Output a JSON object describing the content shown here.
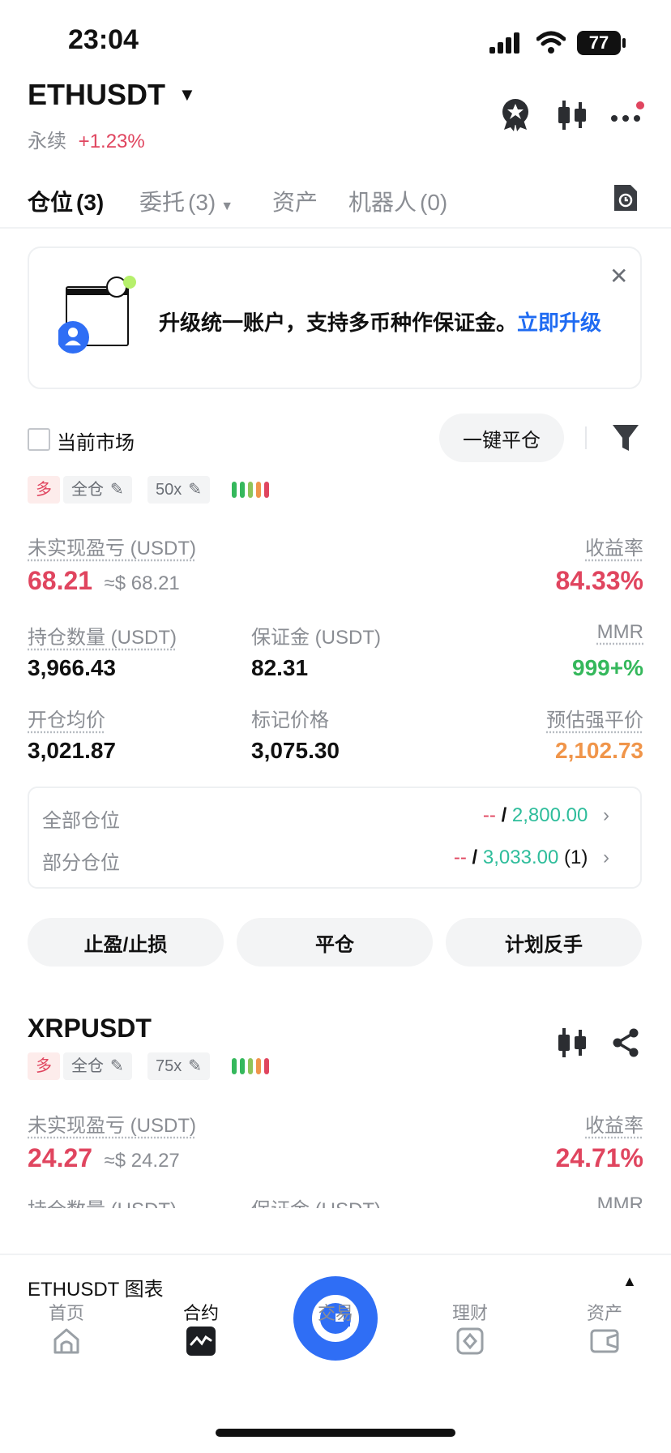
{
  "status_bar": {
    "time": "23:04",
    "battery": "77"
  },
  "header": {
    "symbol": "ETHUSDT",
    "type": "永续",
    "change": "+1.23%"
  },
  "tabs": [
    {
      "label": "仓位",
      "count": "(3)"
    },
    {
      "label": "委托",
      "count": "(3)"
    },
    {
      "label": "资产",
      "count": ""
    },
    {
      "label": "机器人",
      "count": "(0)"
    }
  ],
  "banner": {
    "text": "升级统一账户，支持多币种作保证金。",
    "link": "立即升级"
  },
  "filter_bar": {
    "current_market": "当前市场",
    "close_all": "一键平仓"
  },
  "position1": {
    "side": "多",
    "margin_mode": "全仓",
    "leverage": "50x",
    "pnl_label": "未实现盈亏 (USDT)",
    "pnl": "68.21",
    "pnl_usd": "≈$ 68.21",
    "roe_label": "收益率",
    "roe": "84.33%",
    "size_label": "持仓数量 (USDT)",
    "size": "3,966.43",
    "margin_label": "保证金 (USDT)",
    "margin": "82.31",
    "mmr_label": "MMR",
    "mmr": "999+%",
    "entry_label": "开仓均价",
    "entry": "3,021.87",
    "mark_label": "标记价格",
    "mark": "3,075.30",
    "liq_label": "预估强平价",
    "liq": "2,102.73",
    "tpsl": [
      {
        "label": "全部仓位",
        "tp": "--",
        "sep": "/",
        "sl": "2,800.00",
        "count": ""
      },
      {
        "label": "部分仓位",
        "tp": "--",
        "sep": "/",
        "sl": "3,033.00",
        "count": "(1)"
      }
    ],
    "actions": [
      "止盈/止损",
      "平仓",
      "计划反手"
    ]
  },
  "position2": {
    "symbol": "XRPUSDT",
    "side": "多",
    "margin_mode": "全仓",
    "leverage": "75x",
    "pnl_label": "未实现盈亏 (USDT)",
    "pnl": "24.27",
    "pnl_usd": "≈$ 24.27",
    "roe_label": "收益率",
    "roe": "24.71%",
    "size_label": "持仓数量 (USDT)",
    "margin_label": "保证金 (USDT)",
    "mmr_label": "MMR"
  },
  "chart_bar": {
    "label": "ETHUSDT 图表"
  },
  "bottom_nav": [
    "首页",
    "合约",
    "交易",
    "理财",
    "资产"
  ],
  "colors": {
    "accent": "#1f6bf2",
    "loss": "#e0455f",
    "gain": "#35b85c",
    "liq": "#f0954a"
  }
}
